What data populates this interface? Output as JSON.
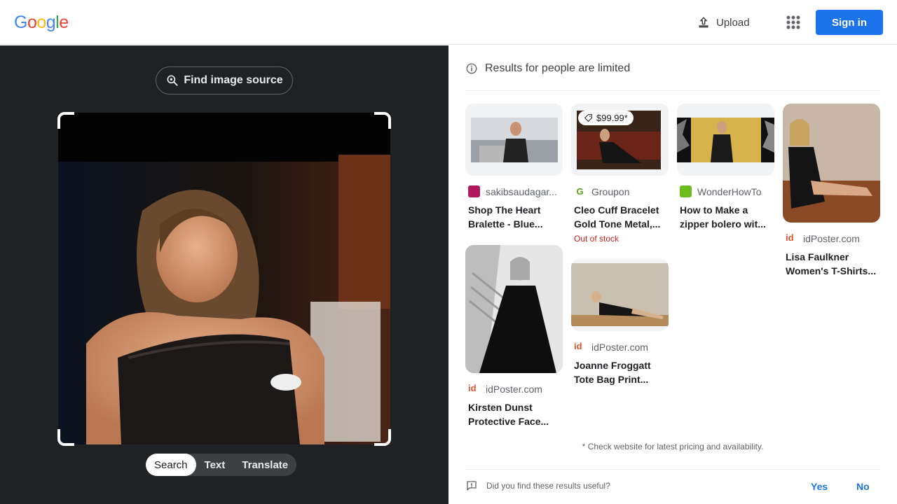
{
  "header": {
    "logo_letters": [
      "G",
      "o",
      "o",
      "g",
      "l",
      "e"
    ],
    "logo_colors": [
      "#4285f4",
      "#ea4335",
      "#fbbc05",
      "#4285f4",
      "#34a853",
      "#ea4335"
    ],
    "upload_label": "Upload",
    "apps_icon": "apps-grid-icon",
    "signin_label": "Sign in"
  },
  "left": {
    "find_source_label": "Find image source",
    "modes": [
      {
        "label": "Search",
        "active": true
      },
      {
        "label": "Text",
        "active": false
      },
      {
        "label": "Translate",
        "active": false
      }
    ]
  },
  "right": {
    "limited_notice": "Results for people are limited",
    "results": [
      {
        "source": "sakibsaudagar...",
        "title_lines": [
          "Shop The Heart",
          "Bralette - Blue..."
        ],
        "favicon_color": "#b0185e"
      },
      {
        "source": "Groupon",
        "title_lines": [
          "Cleo Cuff Bracelet",
          "Gold Tone Metal,..."
        ],
        "price": "$99.99*",
        "stock": "Out of stock",
        "favicon_color": "#53a318"
      },
      {
        "source": "WonderHowTo",
        "title_lines": [
          "How to Make a",
          "zipper bolero wit..."
        ],
        "favicon_color": "#6dbb1e"
      },
      {
        "source": "idPoster.com",
        "title_lines": [
          "Lisa Faulkner",
          "Women's T-Shirts..."
        ],
        "favicon_color": "#e0522c"
      },
      {
        "source": "idPoster.com",
        "title_lines": [
          "Kirsten Dunst",
          "Protective Face..."
        ],
        "favicon_color": "#e0522c"
      },
      {
        "source": "idPoster.com",
        "title_lines": [
          "Joanne Froggatt",
          "Tote Bag Print..."
        ],
        "favicon_color": "#e0522c"
      }
    ],
    "disclaimer": "* Check website for latest pricing and availability.",
    "feedback_question": "Did you find these results useful?",
    "yes_label": "Yes",
    "no_label": "No"
  }
}
